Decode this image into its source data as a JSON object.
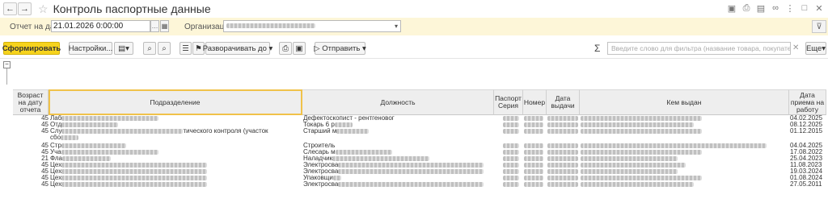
{
  "window": {
    "title": "Контроль паспортные данные",
    "back_icon": "arrow-left-icon",
    "forward_icon": "arrow-right-icon",
    "favorite_icon": "star-icon"
  },
  "params": {
    "date_label": "Отчет на дату:",
    "date_value": "21.01.2026  0:00:00",
    "org_label": "Организация:"
  },
  "toolbar": {
    "generate_label": "Сформировать",
    "settings_label": "Настройки...",
    "expand_label": "Разворачивать до",
    "send_label": "Отправить",
    "more_label": "Еще",
    "search_placeholder": "Введите слово для фильтра (название товара, покупателя и т.п.)",
    "sum_symbol": "Σ"
  },
  "table": {
    "columns": {
      "age": "Возраст на дату отчета",
      "division": "Подразделение",
      "position": "Должность",
      "series": "Паспорт Серия",
      "number": "Номер",
      "issue_date": "Дата выдачи",
      "issued_by": "Кем выдан",
      "hire_date": "Дата приема на работу"
    },
    "rows": [
      {
        "age": "45",
        "division": "Лаб",
        "position": "Дефектоскопист - рентгеновог",
        "hire": "04.02.2025"
      },
      {
        "age": "45",
        "division": "Отд",
        "position": "Токарь 6 р",
        "hire": "08.12.2025"
      },
      {
        "age": "45",
        "division": "Слу",
        "division_tail": "тического контроля (участок",
        "position": "Старший м",
        "hire": "01.12.2015"
      },
      {
        "age": "",
        "division": "сбо",
        "position": "",
        "hire": ""
      },
      {
        "age": "45",
        "division": "Стр",
        "position": "Строитель",
        "hire": "04.04.2025"
      },
      {
        "age": "45",
        "division": "Уча",
        "position": "Слесарь м",
        "hire": "17.08.2022"
      },
      {
        "age": "21",
        "division": "Фла",
        "position": "Наладчик",
        "hire": "25.04.2023"
      },
      {
        "age": "45",
        "division": "Цех",
        "position": "Электросва",
        "hire": "11.08.2023"
      },
      {
        "age": "45",
        "division": "Цех",
        "position": "Электросва",
        "hire": "19.03.2024"
      },
      {
        "age": "45",
        "division": "Цех",
        "position": "Упаковщи",
        "hire": "01.08.2024"
      },
      {
        "age": "45",
        "division": "Цех",
        "position": "Электросва",
        "hire": "27.05.2011"
      }
    ]
  }
}
